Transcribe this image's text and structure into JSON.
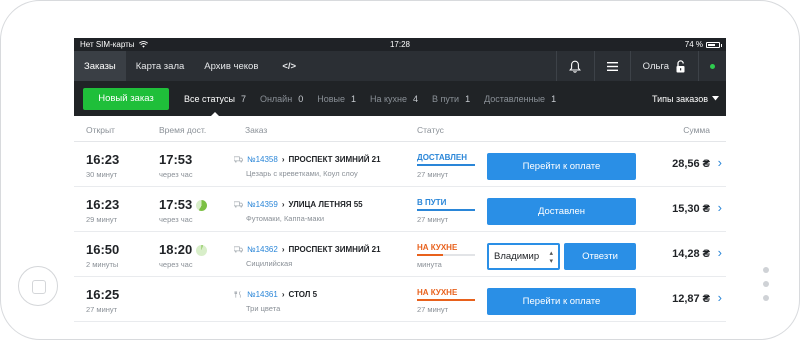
{
  "device": {
    "status": {
      "carrier": "Нет SIM-карты",
      "time": "17:28",
      "battery": "74 %",
      "battery_level": 0.74
    }
  },
  "nav": {
    "tabs": [
      "Заказы",
      "Карта зала",
      "Архив чеков"
    ],
    "code_label": "</>",
    "user": "Ольга"
  },
  "filters": {
    "new_order": "Новый заказ",
    "statuses": [
      {
        "label": "Все статусы",
        "count": "7"
      },
      {
        "label": "Онлайн",
        "count": "0"
      },
      {
        "label": "Новые",
        "count": "1"
      },
      {
        "label": "На кухне",
        "count": "4"
      },
      {
        "label": "В пути",
        "count": "1"
      },
      {
        "label": "Доставленные",
        "count": "1"
      }
    ],
    "order_types": "Типы заказов"
  },
  "table": {
    "headers": {
      "opened": "Открыт",
      "prep": "Время дост.",
      "order": "Заказ",
      "status": "Статус",
      "sum": "Сумма"
    },
    "rows": [
      {
        "opened": "16:23",
        "opened_ago": "30 минут",
        "prep": "17:53",
        "prep_sub": "через час",
        "number": "№14358",
        "address": "ПРОСПЕКТ ЗИМНИЙ 21",
        "items": "Цезарь с креветками, Коул слоу",
        "status": "ДОСТАВЛЕН",
        "status_time": "27 минут",
        "action": "Перейти к оплате",
        "sum": "28,56 ₴"
      },
      {
        "opened": "16:23",
        "opened_ago": "29 минут",
        "prep": "17:53",
        "prep_sub": "через час",
        "number": "№14359",
        "address": "УЛИЦА ЛЕТНЯЯ 55",
        "items": "Футомаки, Каппа-маки",
        "status": "В ПУТИ",
        "status_time": "27 минут",
        "action": "Доставлен",
        "sum": "15,30 ₴"
      },
      {
        "opened": "16:50",
        "opened_ago": "2 минуты",
        "prep": "18:20",
        "prep_sub": "через час",
        "number": "№14362",
        "address": "ПРОСПЕКТ ЗИМНИЙ 21",
        "items": "Сицилийская",
        "status": "НА КУХНЕ",
        "status_time": "минута",
        "courier": "Владимир",
        "action": "Отвезти",
        "sum": "14,28 ₴"
      },
      {
        "opened": "16:25",
        "opened_ago": "27 минут",
        "number": "№14361",
        "address": "СТОЛ 5",
        "items": "Три цвета",
        "status": "НА КУХНЕ",
        "status_time": "27 минут",
        "action": "Перейти к оплате",
        "sum": "12,87 ₴"
      }
    ]
  },
  "colors": {
    "accent": "#2a8fe6",
    "green": "#1fbf3a",
    "delivered": "#2a86d8",
    "kitchen": "#e8611c"
  }
}
